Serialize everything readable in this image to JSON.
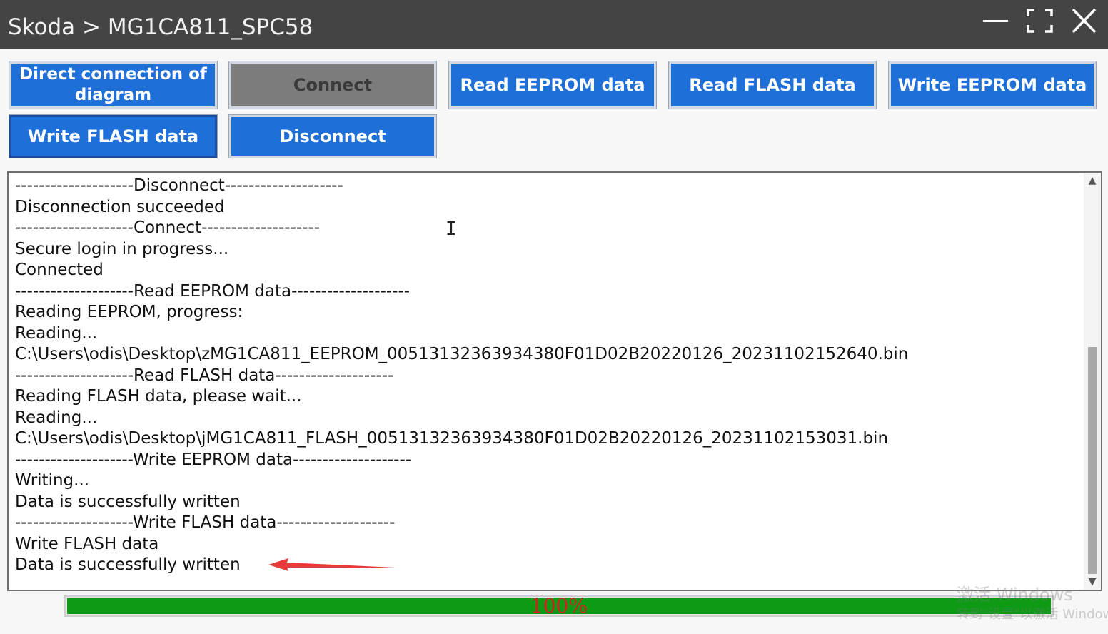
{
  "window": {
    "title": "Skoda > MG1CA811_SPC58",
    "controls": {
      "minimize_icon": "minimize-icon",
      "maximize_icon": "maximize-icon",
      "close_icon": "close-icon"
    }
  },
  "toolbar": {
    "direct_connection": "Direct connection of diagram",
    "connect": "Connect",
    "read_eeprom": "Read EEPROM data",
    "read_flash": "Read FLASH data",
    "write_eeprom": "Write EEPROM data",
    "write_flash": "Write FLASH data",
    "disconnect": "Disconnect"
  },
  "log": {
    "lines": [
      "--------------------Disconnect--------------------",
      "Disconnection succeeded",
      "--------------------Connect--------------------",
      "Secure login in progress...",
      "Connected",
      "--------------------Read EEPROM data--------------------",
      "Reading EEPROM, progress:",
      "Reading...",
      "C:\\Users\\odis\\Desktop\\zMG1CA811_EEPROM_00513132363934380F01D02B20220126_20231102152640.bin",
      "--------------------Read FLASH data--------------------",
      "Reading FLASH data, please wait...",
      "Reading...",
      "C:\\Users\\odis\\Desktop\\jMG1CA811_FLASH_00513132363934380F01D02B20220126_20231102153031.bin",
      "--------------------Write EEPROM data--------------------",
      "Writing...",
      "Data is successfully written",
      "--------------------Write FLASH data--------------------",
      "Write FLASH data",
      "Data is successfully written"
    ]
  },
  "progress": {
    "value": 1.0,
    "label": "100%"
  },
  "watermark": {
    "line1": "激活 Windows",
    "line2": "转到\"设置\"以激活 Windows。"
  },
  "colors": {
    "titlebar": "#444444",
    "button_blue": "#1f6fd8",
    "button_disabled": "#7c7c7c",
    "progress_green": "#0f9a16",
    "progress_text": "#d12020",
    "annotation_arrow": "#e53b3b"
  }
}
